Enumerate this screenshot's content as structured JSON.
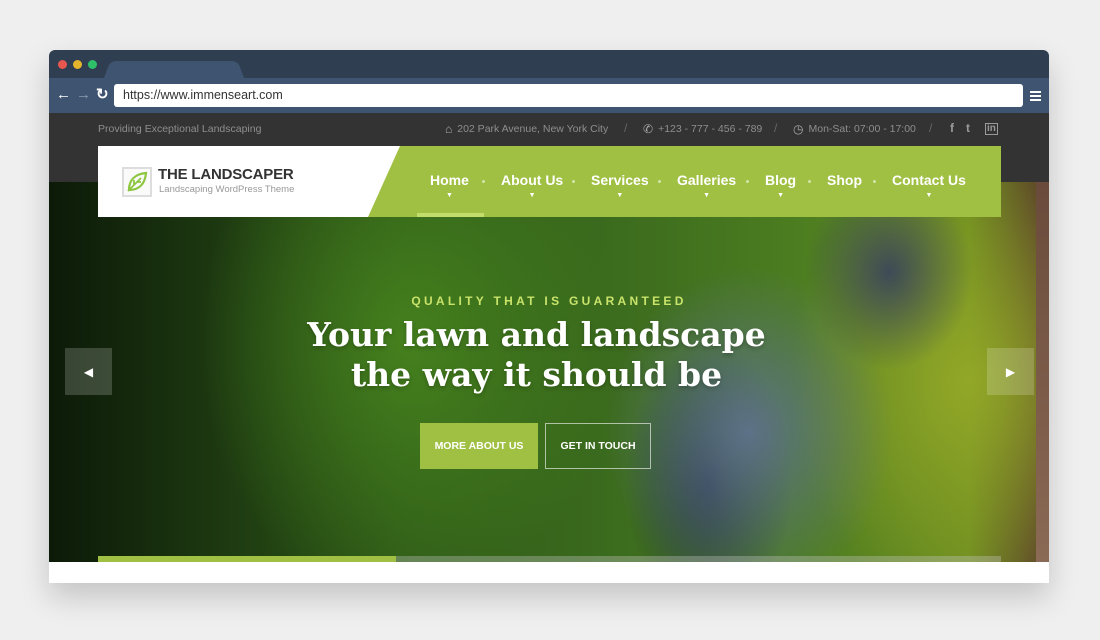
{
  "browser": {
    "url": "https://www.immenseart.com",
    "back_icon": "←",
    "forward_icon": "→",
    "reload_icon": "↻"
  },
  "topbar": {
    "tagline": "Providing Exceptional Landscaping",
    "address": "202 Park Avenue, New York City",
    "phone": "+123 - 777 - 456 - 789",
    "hours": "Mon-Sat: 07:00 - 17:00",
    "separator": "/",
    "home_icon": "⌂",
    "phone_icon": "✆",
    "clock_icon": "◷",
    "social": {
      "facebook": "f",
      "twitter": "t",
      "linkedin": "in"
    }
  },
  "logo": {
    "title": "THE LANDSCAPER",
    "subtitle": "Landscaping WordPress Theme",
    "color": "#8dc63f"
  },
  "nav": {
    "items": [
      {
        "label": "Home",
        "has_dropdown": true,
        "active": true
      },
      {
        "label": "About Us",
        "has_dropdown": true
      },
      {
        "label": "Services",
        "has_dropdown": true
      },
      {
        "label": "Galleries",
        "has_dropdown": true
      },
      {
        "label": "Blog",
        "has_dropdown": true
      },
      {
        "label": "Shop",
        "has_dropdown": false
      },
      {
        "label": "Contact Us",
        "has_dropdown": true
      }
    ],
    "caret": "▼",
    "accent": "#a0c043"
  },
  "hero": {
    "eyebrow": "QUALITY THAT IS GUARANTEED",
    "headline_line1": "Your lawn and landscape",
    "headline_line2": "the way it should be",
    "primary_cta": "MORE ABOUT US",
    "secondary_cta": "GET IN TOUCH",
    "prev_icon": "◀",
    "next_icon": "▶",
    "slide_progress_percent": 33
  }
}
